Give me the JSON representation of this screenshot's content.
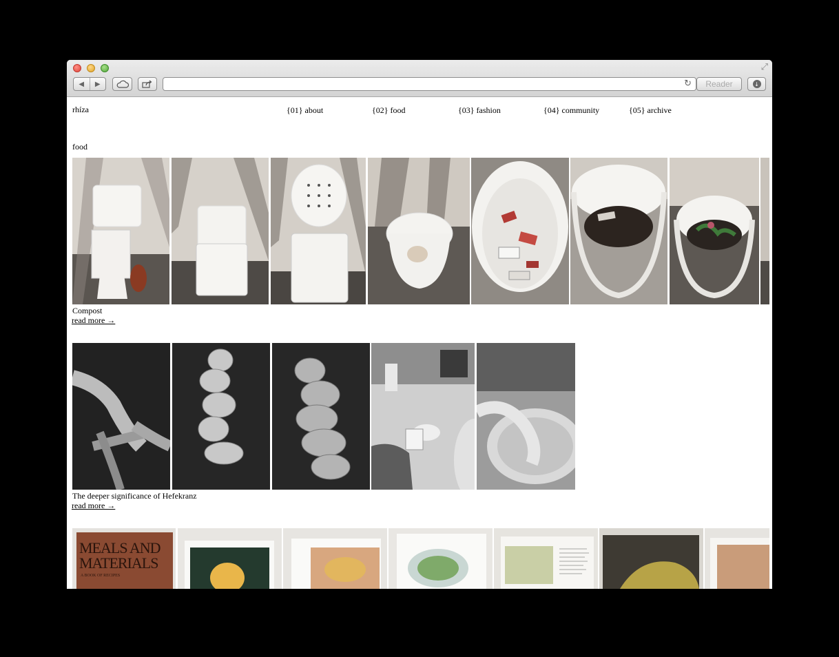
{
  "browser": {
    "reader_label": "Reader",
    "address_value": ""
  },
  "site": {
    "logo": "rhíza",
    "nav": [
      {
        "label": "{01} about"
      },
      {
        "label": "{02} food"
      },
      {
        "label": "{03} fashion"
      },
      {
        "label": "{04} community"
      },
      {
        "label": "{05} archive"
      }
    ]
  },
  "section": {
    "heading": "food"
  },
  "articles": [
    {
      "title": "Compost",
      "read_more": "read more →"
    },
    {
      "title": "The deeper significance of Hefekranz",
      "read_more": "read more →"
    },
    {
      "cover_text": "MEALS AND MATERIALS",
      "cover_subtext": "A BOOK OF RECIPES"
    }
  ],
  "colors": {
    "page_bg": "#ffffff",
    "text": "#000000",
    "window_bg": "#000000"
  }
}
